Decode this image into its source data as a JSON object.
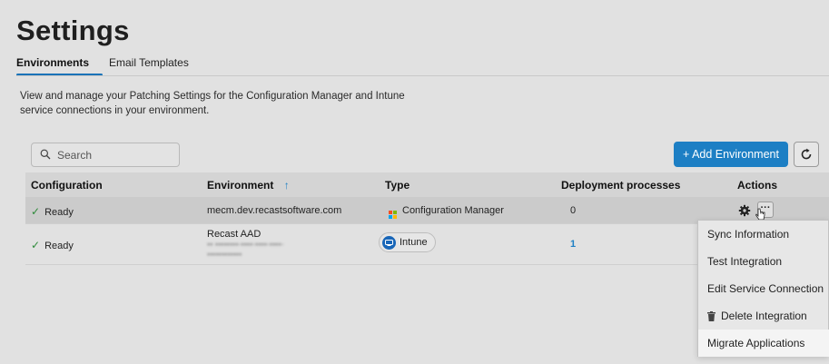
{
  "page": {
    "title": "Settings",
    "tabs": [
      {
        "label": "Environments",
        "active": true
      },
      {
        "label": "Email Templates",
        "active": false
      }
    ],
    "description": "View and manage your Patching Settings for the Configuration Manager and Intune service connections in your environment."
  },
  "toolbar": {
    "search_placeholder": "Search",
    "add_label": "+ Add Environment",
    "icons": {
      "search": "search-icon",
      "refresh": "refresh-icon"
    },
    "accent_color": "#1d7fc4"
  },
  "table": {
    "columns": [
      "Configuration",
      "Environment",
      "Type",
      "Deployment processes",
      "Actions"
    ],
    "sort_indicator": "↑",
    "rows": [
      {
        "configuration": "Ready",
        "environment": "mecm.dev.recastsoftware.com",
        "type": "Configuration Manager",
        "deployment_processes": "0"
      },
      {
        "configuration": "Ready",
        "environment": "Recast AAD",
        "type": "Intune",
        "deployment_processes": "1"
      }
    ]
  },
  "actions_menu": {
    "items": [
      "Sync Information",
      "Test Integration",
      "Edit Service Connection",
      "Delete Integration",
      "Migrate Applications"
    ]
  }
}
